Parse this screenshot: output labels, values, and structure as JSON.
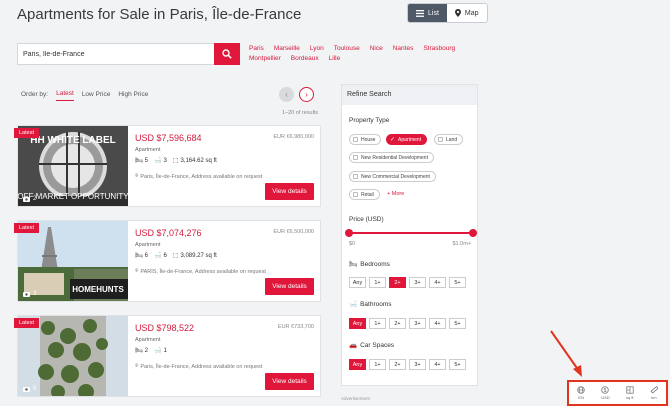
{
  "page_title": "Apartments for Sale in Paris, Île-de-France",
  "view_toggle": {
    "list_label": "List",
    "map_label": "Map",
    "active": "list"
  },
  "search": {
    "value": "Paris, Île-de-France"
  },
  "city_links": [
    "Paris",
    "Marseille",
    "Lyon",
    "Toulouse",
    "Nice",
    "Nantes",
    "Strasbourg",
    "Montpellier",
    "Bordeaux",
    "Lille"
  ],
  "order": {
    "label": "Order by:",
    "options": [
      "Latest",
      "Low Price",
      "High Price"
    ],
    "active": "Latest"
  },
  "results_count": "1–20 of results",
  "listings": [
    {
      "tag": "Latest",
      "photos": "2",
      "price": "USD $7,596,684",
      "eur": "EUR €6,980,000",
      "type": "Apartment",
      "beds": "5",
      "baths": "3",
      "area": "3,164.62 sq ft",
      "location": "Paris, Île-de-France, Address available on request",
      "button": "View details",
      "overlay_top": "HH WHITE LABEL",
      "overlay_bottom": "OFF MARKET OPPORTUNITY"
    },
    {
      "tag": "Latest",
      "photos": "3",
      "price": "USD $7,074,276",
      "eur": "EUR €6,500,000",
      "type": "Apartment",
      "beds": "6",
      "baths": "6",
      "area": "3,089.27 sq ft",
      "location": "PARIS, Île-de-France, Address available on request",
      "button": "View details",
      "overlay_logo": "HOMEHUNTS"
    },
    {
      "tag": "Latest",
      "photos": "5",
      "price": "USD $798,522",
      "eur": "EUR €733,700",
      "type": "Apartment",
      "beds": "2",
      "baths": "1",
      "location": "Paris, Île-de-France, Address available on request",
      "button": "View details"
    }
  ],
  "refine": {
    "title": "Refine Search",
    "property_type_label": "Property Type",
    "property_types": [
      "House",
      "Apartment",
      "Land",
      "New Residential Development",
      "New Commercial Development",
      "Retail"
    ],
    "active_type": "Apartment",
    "more_label": "More",
    "price_label": "Price (USD)",
    "price_min": "$0",
    "price_max": "$1.0m+",
    "bedrooms_label": "Bedrooms",
    "bedrooms_options": [
      "Any",
      "1+",
      "2+",
      "3+",
      "4+",
      "5+"
    ],
    "bedrooms_active": "2+",
    "bathrooms_label": "Bathrooms",
    "bathrooms_options": [
      "Any",
      "1+",
      "2+",
      "3+",
      "4+",
      "5+"
    ],
    "bathrooms_active": "Any",
    "car_label": "Car Spaces",
    "car_options": [
      "Any",
      "1+",
      "2+",
      "3+",
      "4+",
      "5+"
    ],
    "car_active": "Any"
  },
  "advertisement_label": "Advertisement",
  "bottom_tools": [
    {
      "icon": "globe-icon",
      "label": "EN"
    },
    {
      "icon": "dollar-icon",
      "label": "USD"
    },
    {
      "icon": "area-icon",
      "label": "sq ft"
    },
    {
      "icon": "ruler-icon",
      "label": "km"
    }
  ],
  "colors": {
    "accent": "#e0163b",
    "annotation": "#e0341f"
  }
}
